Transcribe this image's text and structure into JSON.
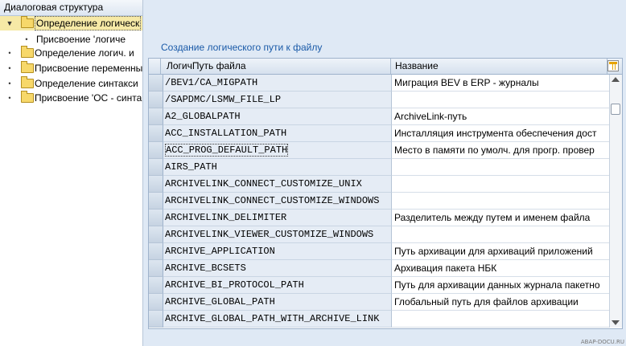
{
  "tree": {
    "title": "Диалоговая структура",
    "nodes": [
      {
        "label": "Определение логическ",
        "expanded": true,
        "selected": true
      },
      {
        "label": "Присвоение 'логиче",
        "child": true
      },
      {
        "label": "Определение логич. и"
      },
      {
        "label": "Присвоение переменны"
      },
      {
        "label": "Определение синтакси"
      },
      {
        "label": "Присвоение 'ОС - синта"
      }
    ]
  },
  "section_title": "Создание логического пути к файлу",
  "table": {
    "columns": [
      "ЛогичПуть файла",
      "Название"
    ],
    "rows": [
      {
        "path": "/BEV1/CA_MIGPATH",
        "name": "Миграция BEV в ERP - журналы"
      },
      {
        "path": "/SAPDMC/LSMW_FILE_LP",
        "name": ""
      },
      {
        "path": "A2_GLOBALPATH",
        "name": "ArchiveLink-путь"
      },
      {
        "path": "ACC_INSTALLATION_PATH",
        "name": "Инсталляция инструмента обеспечения дост"
      },
      {
        "path": "ACC_PROG_DEFAULT_PATH",
        "name": "Место в памяти по умолч. для прогр. провер"
      },
      {
        "path": "AIRS_PATH",
        "name": ""
      },
      {
        "path": "ARCHIVELINK_CONNECT_CUSTOMIZE_UNIX",
        "name": ""
      },
      {
        "path": "ARCHIVELINK_CONNECT_CUSTOMIZE_WINDOWS",
        "name": ""
      },
      {
        "path": "ARCHIVELINK_DELIMITER",
        "name": "Разделитель между путем и именем файла"
      },
      {
        "path": "ARCHIVELINK_VIEWER_CUSTOMIZE_WINDOWS",
        "name": ""
      },
      {
        "path": "ARCHIVE_APPLICATION",
        "name": "Путь архивации для архиваций приложений"
      },
      {
        "path": "ARCHIVE_BCSETS",
        "name": "Архивация пакета НБК"
      },
      {
        "path": "ARCHIVE_BI_PROTOCOL_PATH",
        "name": "Путь для архивации данных журнала пакетно"
      },
      {
        "path": "ARCHIVE_GLOBAL_PATH",
        "name": "Глобальный путь для файлов архивации"
      },
      {
        "path": "ARCHIVE_GLOBAL_PATH_WITH_ARCHIVE_LINK",
        "name": ""
      }
    ]
  },
  "colors": {
    "background": "#dfe9f5",
    "title": "#1a5aa8",
    "selected_node": "#f6e9a6"
  },
  "icons": [
    "folder-icon",
    "column-config-icon",
    "scroll-up-icon",
    "scroll-down-icon"
  ],
  "watermark": "ABAP-DOCU.RU"
}
